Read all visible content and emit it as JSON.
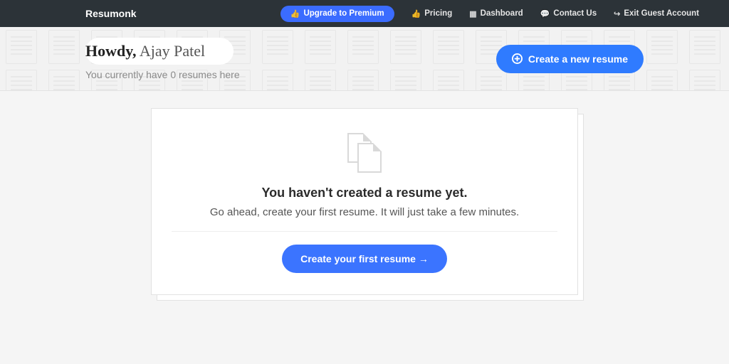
{
  "navbar": {
    "brand": "Resumonk",
    "premium_label": "Upgrade to Premium",
    "items": [
      {
        "icon": "thumbs-up",
        "label": "Pricing"
      },
      {
        "icon": "calendar",
        "label": "Dashboard"
      },
      {
        "icon": "comment",
        "label": "Contact Us"
      },
      {
        "icon": "exit",
        "label": "Exit Guest Account"
      }
    ]
  },
  "header": {
    "greeting_prefix": "Howdy,",
    "user_name": "Ajay Patel",
    "subline": "You currently have 0 resumes here",
    "create_button": "Create a new resume"
  },
  "empty_state": {
    "title": "You haven't created a resume yet.",
    "subtitle": "Go ahead, create your first resume. It will just take a few minutes.",
    "cta": "Create your first resume →"
  },
  "colors": {
    "navbar_bg": "#2c3338",
    "primary_blue": "#3b6cff"
  }
}
